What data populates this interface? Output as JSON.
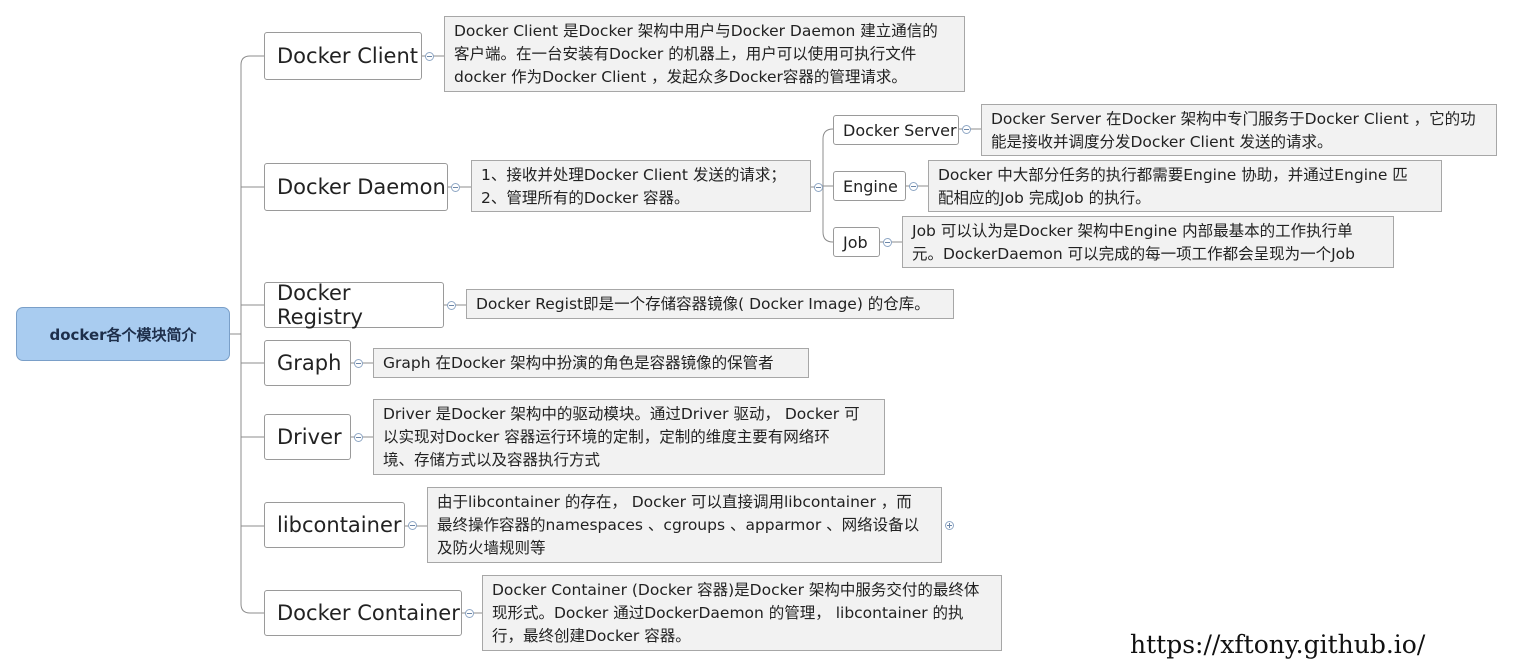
{
  "root": {
    "label": "docker各个模块简介"
  },
  "topics": {
    "client": {
      "label": "Docker Client",
      "note": [
        "Docker Client 是Docker 架构中用户与Docker Daemon 建立通信的",
        "客户端。在一台安装有Docker 的机器上，用户可以使用可执行文件",
        "docker 作为Docker Client ，发起众多Docker容器的管理请求。"
      ]
    },
    "daemon": {
      "label": "Docker Daemon",
      "note": [
        "1、接收并处理Docker Client 发送的请求；",
        "2、管理所有的Docker 容器。"
      ],
      "children": {
        "server": {
          "label": "Docker Server",
          "note": [
            "Docker Server 在Docker 架构中专门服务于Docker Client ，它的功",
            "能是接收并调度分发Docker Client 发送的请求。"
          ]
        },
        "engine": {
          "label": "Engine",
          "note": [
            "Docker 中大部分任务的执行都需要Engine 协助，并通过Engine 匹",
            "配相应的Job 完成Job 的执行。"
          ]
        },
        "job": {
          "label": "Job",
          "note": [
            "Job 可以认为是Docker 架构中Engine 内部最基本的工作执行单",
            "元。DockerDaemon 可以完成的每一项工作都会呈现为一个Job"
          ]
        }
      }
    },
    "registry": {
      "label": "Docker Registry",
      "note": [
        "Docker Regist即是一个存储容器镜像( Docker Image) 的仓库。"
      ]
    },
    "graph": {
      "label": "Graph",
      "note": [
        "Graph 在Docker 架构中扮演的角色是容器镜像的保管者"
      ]
    },
    "driver": {
      "label": "Driver",
      "note": [
        "Driver 是Docker 架构中的驱动模块。通过Driver 驱动， Docker 可",
        "以实现对Docker 容器运行环境的定制，定制的维度主要有网络环",
        "境、存储方式以及容器执行方式"
      ]
    },
    "libcontainer": {
      "label": "libcontainer",
      "note": [
        "由于libcontainer 的存在， Docker 可以直接调用libcontainer ，而",
        "最终操作容器的namespaces 、cgroups 、apparmor 、网络设备以",
        "及防火墙规则等"
      ]
    },
    "container": {
      "label": "Docker Container",
      "note": [
        "Docker Container (Docker 容器)是Docker 架构中服务交付的最终体",
        "现形式。Docker 通过DockerDaemon 的管理， libcontainer 的执",
        "行，最终创建Docker 容器。"
      ]
    }
  },
  "watermark": "https://xftony.github.io/"
}
